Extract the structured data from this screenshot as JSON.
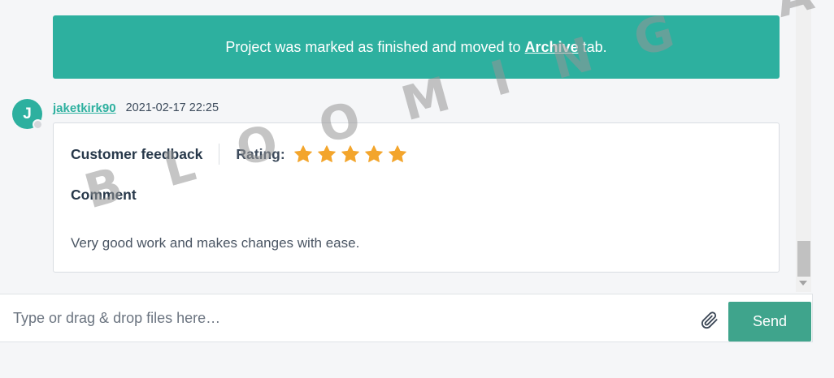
{
  "banner": {
    "text_before": "Project was marked as finished and moved to",
    "link": "Archive",
    "text_after": "tab."
  },
  "message": {
    "avatar_initial": "J",
    "username": "jaketkirk90",
    "timestamp": "2021-02-17 22:25"
  },
  "feedback": {
    "title": "Customer feedback",
    "rating_label": "Rating:",
    "rating_value": 5,
    "rating_max": 5,
    "comment_title": "Comment",
    "comment_text": "Very good work and makes changes with ease."
  },
  "composer": {
    "placeholder": "Type or drag & drop files here…",
    "send_label": "Send"
  },
  "watermark": "BLOOMING ANIMATION",
  "colors": {
    "accent": "#2db09f",
    "send_button": "#3fa48c",
    "star": "#f3a52c"
  }
}
